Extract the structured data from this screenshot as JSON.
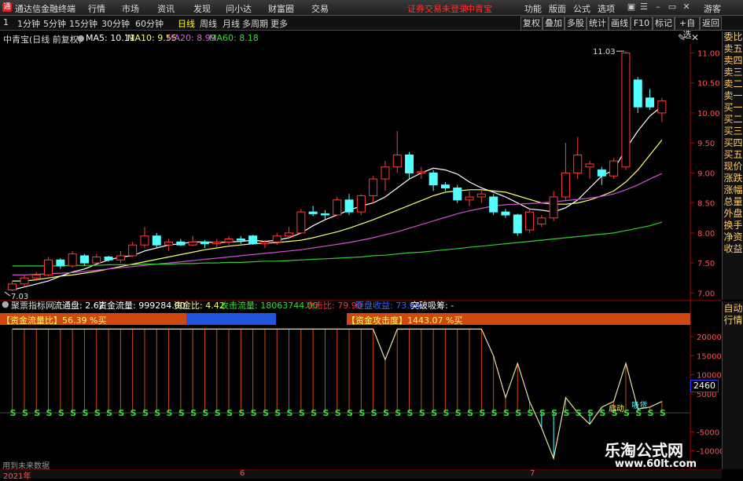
{
  "titlebar": {
    "app_name": "通达信金融终端",
    "menus": [
      "行情",
      "市场",
      "资讯",
      "发现",
      "问小达",
      "财富圈",
      "交易"
    ],
    "warning": "证券交易未登录",
    "stock": "中青宝",
    "right_menus": [
      "功能",
      "版面",
      "公式",
      "选项"
    ],
    "user": "游客"
  },
  "periods": [
    "1",
    "1分钟",
    "5分钟",
    "15分钟",
    "30分钟",
    "60分钟",
    "日线",
    "周线",
    "月线",
    "多周期",
    "更多"
  ],
  "active_period": "日线",
  "right_toolbar": [
    "复权",
    "叠加",
    "多股",
    "统计",
    "画线",
    "F10",
    "标记",
    "+自选",
    "返回"
  ],
  "legend": {
    "title": "中青宝(日线 前复权)",
    "ma5": "MA5: 10.11",
    "ma10": "MA10: 9.55",
    "ma20": "MA20: 8.99",
    "ma60": "MA60: 8.18"
  },
  "colors": {
    "up": "#ff3c3c",
    "down": "#55ffff",
    "ma5": "#ffffff",
    "ma10": "#ffff66",
    "ma20": "#d050d0",
    "ma60": "#33cc33"
  },
  "price_side": [
    "委比",
    "卖五",
    "卖四",
    "卖三",
    "卖二",
    "卖一",
    "买一",
    "买二",
    "买三",
    "买四",
    "买五",
    "现价",
    "涨跌",
    "涨幅",
    "总量",
    "外盘",
    "换手",
    "净资",
    "收益"
  ],
  "indicator_side": [
    "自动",
    "行情"
  ],
  "indicator_legend": {
    "name": "聚票指标网",
    "float": "流通盘: 2.62",
    "flow": "资金流量: 999284.00",
    "ratio": "资金比: 4.42",
    "attack": "攻击流量: 18063744.00",
    "attack_ratio": "攻击比: 79.90",
    "dump": "砸盘收益: 73.64",
    "breakout": "突破吸筹: -"
  },
  "indicator_tags": {
    "flow_ratio": "【资金流量比】56.39 %买",
    "attack_level": "【资金攻击度】1443.07 %买"
  },
  "current_value_badge": "2460",
  "signal_text": "启动",
  "signal_text2": "吸货",
  "footer": {
    "note": "用到未来数据",
    "year": "2021年",
    "m6": "6",
    "m7": "7"
  },
  "watermark": {
    "name": "乐淘公式网",
    "url": "www.60lt.com"
  },
  "chart_data": [
    {
      "type": "candlestick",
      "title": "中青宝(日线 前复权)",
      "ylim": [
        6.9,
        11.15
      ],
      "y_ticks": [
        7.0,
        7.5,
        8.0,
        8.5,
        9.0,
        9.5,
        10.0,
        10.5,
        11.0
      ],
      "annotations": [
        {
          "label": "11.03",
          "value": 11.03
        },
        {
          "label": "7.03",
          "value": 7.03
        }
      ],
      "candles": [
        [
          7.05,
          7.2,
          7.03,
          7.15
        ],
        [
          7.15,
          7.3,
          7.1,
          7.25
        ],
        [
          7.25,
          7.35,
          7.2,
          7.3
        ],
        [
          7.3,
          7.6,
          7.28,
          7.55
        ],
        [
          7.55,
          7.58,
          7.4,
          7.45
        ],
        [
          7.45,
          7.7,
          7.42,
          7.65
        ],
        [
          7.62,
          7.65,
          7.45,
          7.5
        ],
        [
          7.5,
          7.65,
          7.48,
          7.6
        ],
        [
          7.6,
          7.62,
          7.52,
          7.55
        ],
        [
          7.55,
          7.7,
          7.5,
          7.62
        ],
        [
          7.62,
          7.85,
          7.6,
          7.8
        ],
        [
          7.8,
          8.1,
          7.75,
          7.95
        ],
        [
          7.95,
          8.0,
          7.75,
          7.8
        ],
        [
          7.8,
          7.9,
          7.7,
          7.85
        ],
        [
          7.85,
          7.9,
          7.78,
          7.8
        ],
        [
          7.8,
          7.95,
          7.78,
          7.85
        ],
        [
          7.85,
          7.88,
          7.75,
          7.82
        ],
        [
          7.82,
          7.9,
          7.75,
          7.85
        ],
        [
          7.85,
          7.95,
          7.8,
          7.9
        ],
        [
          7.9,
          7.95,
          7.82,
          7.88
        ],
        [
          7.95,
          7.97,
          7.8,
          7.82
        ],
        [
          7.82,
          7.88,
          7.75,
          7.85
        ],
        [
          7.85,
          8.0,
          7.8,
          7.95
        ],
        [
          7.95,
          8.1,
          7.9,
          8.0
        ],
        [
          8.0,
          8.4,
          7.98,
          8.35
        ],
        [
          8.35,
          8.45,
          8.28,
          8.32
        ],
        [
          8.32,
          8.38,
          8.22,
          8.3
        ],
        [
          8.3,
          8.6,
          8.28,
          8.55
        ],
        [
          8.55,
          8.65,
          8.3,
          8.35
        ],
        [
          8.35,
          8.65,
          8.3,
          8.62
        ],
        [
          8.62,
          8.95,
          8.5,
          8.9
        ],
        [
          8.9,
          9.2,
          8.7,
          9.1
        ],
        [
          9.1,
          9.7,
          9.0,
          9.3
        ],
        [
          9.3,
          9.35,
          8.9,
          9.0
        ],
        [
          9.0,
          9.1,
          8.9,
          9.02
        ],
        [
          9.0,
          9.05,
          8.7,
          8.8
        ],
        [
          8.8,
          8.85,
          8.7,
          8.75
        ],
        [
          8.75,
          8.8,
          8.5,
          8.55
        ],
        [
          8.55,
          8.7,
          8.45,
          8.6
        ],
        [
          8.6,
          8.7,
          8.5,
          8.65
        ],
        [
          8.6,
          8.65,
          8.3,
          8.35
        ],
        [
          8.35,
          8.4,
          8.25,
          8.3
        ],
        [
          8.3,
          8.32,
          7.95,
          8.0
        ],
        [
          8.05,
          8.4,
          8.0,
          8.35
        ],
        [
          8.15,
          8.3,
          8.1,
          8.25
        ],
        [
          8.25,
          8.7,
          8.2,
          8.6
        ],
        [
          8.6,
          9.5,
          8.55,
          9.0
        ],
        [
          9.0,
          9.6,
          8.9,
          9.3
        ],
        [
          9.1,
          9.2,
          8.9,
          9.15
        ],
        [
          9.05,
          9.1,
          8.8,
          8.95
        ],
        [
          8.95,
          9.25,
          8.9,
          9.2
        ],
        [
          9.1,
          11.03,
          9.05,
          11.0
        ],
        [
          10.55,
          10.6,
          10.0,
          10.1
        ],
        [
          10.25,
          10.4,
          10.05,
          10.1
        ],
        [
          10.0,
          10.25,
          9.85,
          10.2
        ]
      ],
      "series": [
        {
          "name": "MA5",
          "values": [
            7.05,
            7.1,
            7.15,
            7.2,
            7.28,
            7.35,
            7.4,
            7.48,
            7.55,
            7.6,
            7.62,
            7.7,
            7.75,
            7.8,
            7.82,
            7.85,
            7.85,
            7.84,
            7.85,
            7.86,
            7.88,
            7.86,
            7.88,
            7.92,
            8.0,
            8.12,
            8.22,
            8.3,
            8.38,
            8.45,
            8.5,
            8.6,
            8.75,
            8.9,
            9.0,
            9.08,
            9.05,
            8.98,
            8.85,
            8.75,
            8.68,
            8.6,
            8.5,
            8.4,
            8.38,
            8.35,
            8.42,
            8.55,
            8.75,
            8.95,
            9.05,
            9.4,
            9.7,
            9.95,
            10.11
          ]
        },
        {
          "name": "MA10",
          "values": [
            7.2,
            7.2,
            7.22,
            7.25,
            7.28,
            7.3,
            7.33,
            7.36,
            7.4,
            7.44,
            7.48,
            7.52,
            7.56,
            7.6,
            7.64,
            7.68,
            7.72,
            7.75,
            7.78,
            7.8,
            7.82,
            7.83,
            7.84,
            7.86,
            7.88,
            7.92,
            7.97,
            8.02,
            8.08,
            8.15,
            8.22,
            8.3,
            8.38,
            8.46,
            8.54,
            8.62,
            8.68,
            8.7,
            8.72,
            8.72,
            8.7,
            8.68,
            8.62,
            8.56,
            8.5,
            8.48,
            8.48,
            8.5,
            8.55,
            8.62,
            8.7,
            8.85,
            9.05,
            9.3,
            9.55
          ]
        },
        {
          "name": "MA20",
          "values": [
            7.3,
            7.3,
            7.31,
            7.32,
            7.33,
            7.34,
            7.36,
            7.38,
            7.4,
            7.42,
            7.44,
            7.46,
            7.48,
            7.5,
            7.52,
            7.54,
            7.56,
            7.58,
            7.6,
            7.62,
            7.64,
            7.66,
            7.68,
            7.7,
            7.72,
            7.75,
            7.78,
            7.81,
            7.84,
            7.88,
            7.92,
            7.97,
            8.02,
            8.08,
            8.14,
            8.2,
            8.26,
            8.32,
            8.37,
            8.41,
            8.45,
            8.47,
            8.48,
            8.49,
            8.5,
            8.52,
            8.54,
            8.56,
            8.58,
            8.61,
            8.65,
            8.72,
            8.8,
            8.9,
            8.99
          ]
        },
        {
          "name": "MA60",
          "values": [
            7.45,
            7.45,
            7.45,
            7.45,
            7.45,
            7.46,
            7.46,
            7.46,
            7.47,
            7.47,
            7.47,
            7.48,
            7.48,
            7.48,
            7.49,
            7.49,
            7.5,
            7.5,
            7.51,
            7.51,
            7.52,
            7.53,
            7.53,
            7.54,
            7.55,
            7.56,
            7.57,
            7.58,
            7.59,
            7.6,
            7.62,
            7.63,
            7.65,
            7.67,
            7.68,
            7.7,
            7.72,
            7.74,
            7.76,
            7.78,
            7.8,
            7.82,
            7.84,
            7.86,
            7.88,
            7.9,
            7.92,
            7.94,
            7.96,
            7.98,
            8.0,
            8.04,
            8.08,
            8.12,
            8.18
          ]
        }
      ]
    },
    {
      "type": "line",
      "title": "聚票指标网",
      "ylim": [
        -14000,
        26000
      ],
      "y_ticks": [
        20000,
        15000,
        10000,
        5000,
        -5000,
        -10000
      ],
      "series": [
        {
          "name": "攻击流量",
          "values": [
            22000,
            22000,
            22000,
            22000,
            22000,
            22000,
            22000,
            22000,
            22000,
            22000,
            22000,
            22000,
            22000,
            22000,
            22000,
            22000,
            22000,
            22000,
            22000,
            22000,
            22000,
            22000,
            22000,
            22000,
            22000,
            22000,
            22000,
            22000,
            22000,
            22000,
            22000,
            14000,
            22000,
            22000,
            22000,
            22000,
            22000,
            22000,
            22000,
            22000,
            15000,
            4000,
            13000,
            3000,
            -4000,
            -12000,
            4000,
            0,
            -3000,
            1500,
            3000,
            13000,
            1000,
            1500,
            3000
          ]
        }
      ]
    }
  ]
}
